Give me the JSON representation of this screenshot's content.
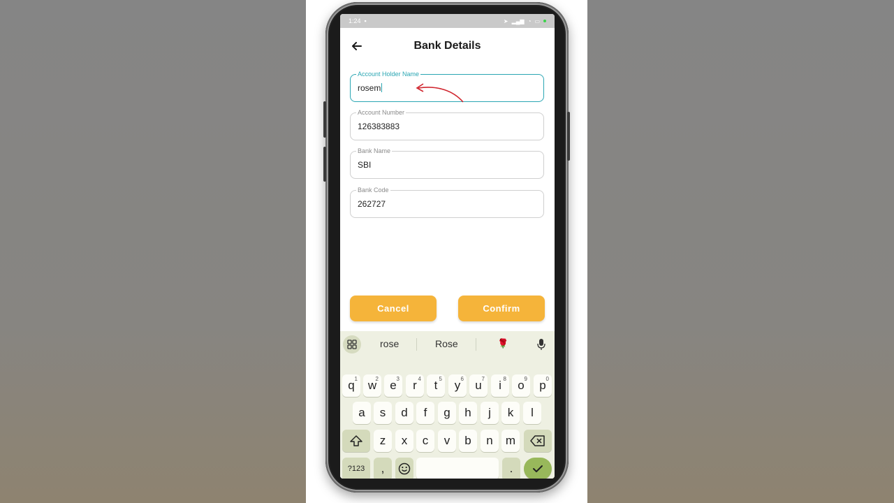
{
  "status_bar": {
    "time": "1:24",
    "icons": [
      "video-icon",
      "location-icon",
      "signal-icon",
      "wifi-icon",
      "battery-icon"
    ]
  },
  "header": {
    "title": "Bank Details",
    "back_icon": "arrow-left-icon"
  },
  "form": {
    "fields": [
      {
        "label": "Account Holder Name",
        "value": "rosem",
        "active": true
      },
      {
        "label": "Account Number",
        "value": "126383883",
        "active": false
      },
      {
        "label": "Bank Name",
        "value": "SBI",
        "active": false
      },
      {
        "label": "Bank Code",
        "value": "262727",
        "active": false
      }
    ]
  },
  "actions": {
    "cancel_label": "Cancel",
    "confirm_label": "Confirm"
  },
  "colors": {
    "accent": "#f5b43a",
    "focus": "#2aa6b3",
    "annotation": "#d0262f",
    "keyboard_bg": "#eef0e2",
    "enter_key": "#98b85b"
  },
  "keyboard": {
    "suggestions": [
      "rose",
      "Rose",
      "🌹"
    ],
    "row1": [
      [
        "q",
        "1"
      ],
      [
        "w",
        "2"
      ],
      [
        "e",
        "3"
      ],
      [
        "r",
        "4"
      ],
      [
        "t",
        "5"
      ],
      [
        "y",
        "6"
      ],
      [
        "u",
        "7"
      ],
      [
        "i",
        "8"
      ],
      [
        "o",
        "9"
      ],
      [
        "p",
        "0"
      ]
    ],
    "row2": [
      "a",
      "s",
      "d",
      "f",
      "g",
      "h",
      "j",
      "k",
      "l"
    ],
    "row3": [
      "z",
      "x",
      "c",
      "v",
      "b",
      "n",
      "m"
    ],
    "bottom": {
      "symbols": "?123",
      "comma": ",",
      "period": "."
    },
    "icons": [
      "grid-icon",
      "mic-icon",
      "shift-icon",
      "backspace-icon",
      "emoji-icon",
      "checkmark-icon"
    ]
  }
}
